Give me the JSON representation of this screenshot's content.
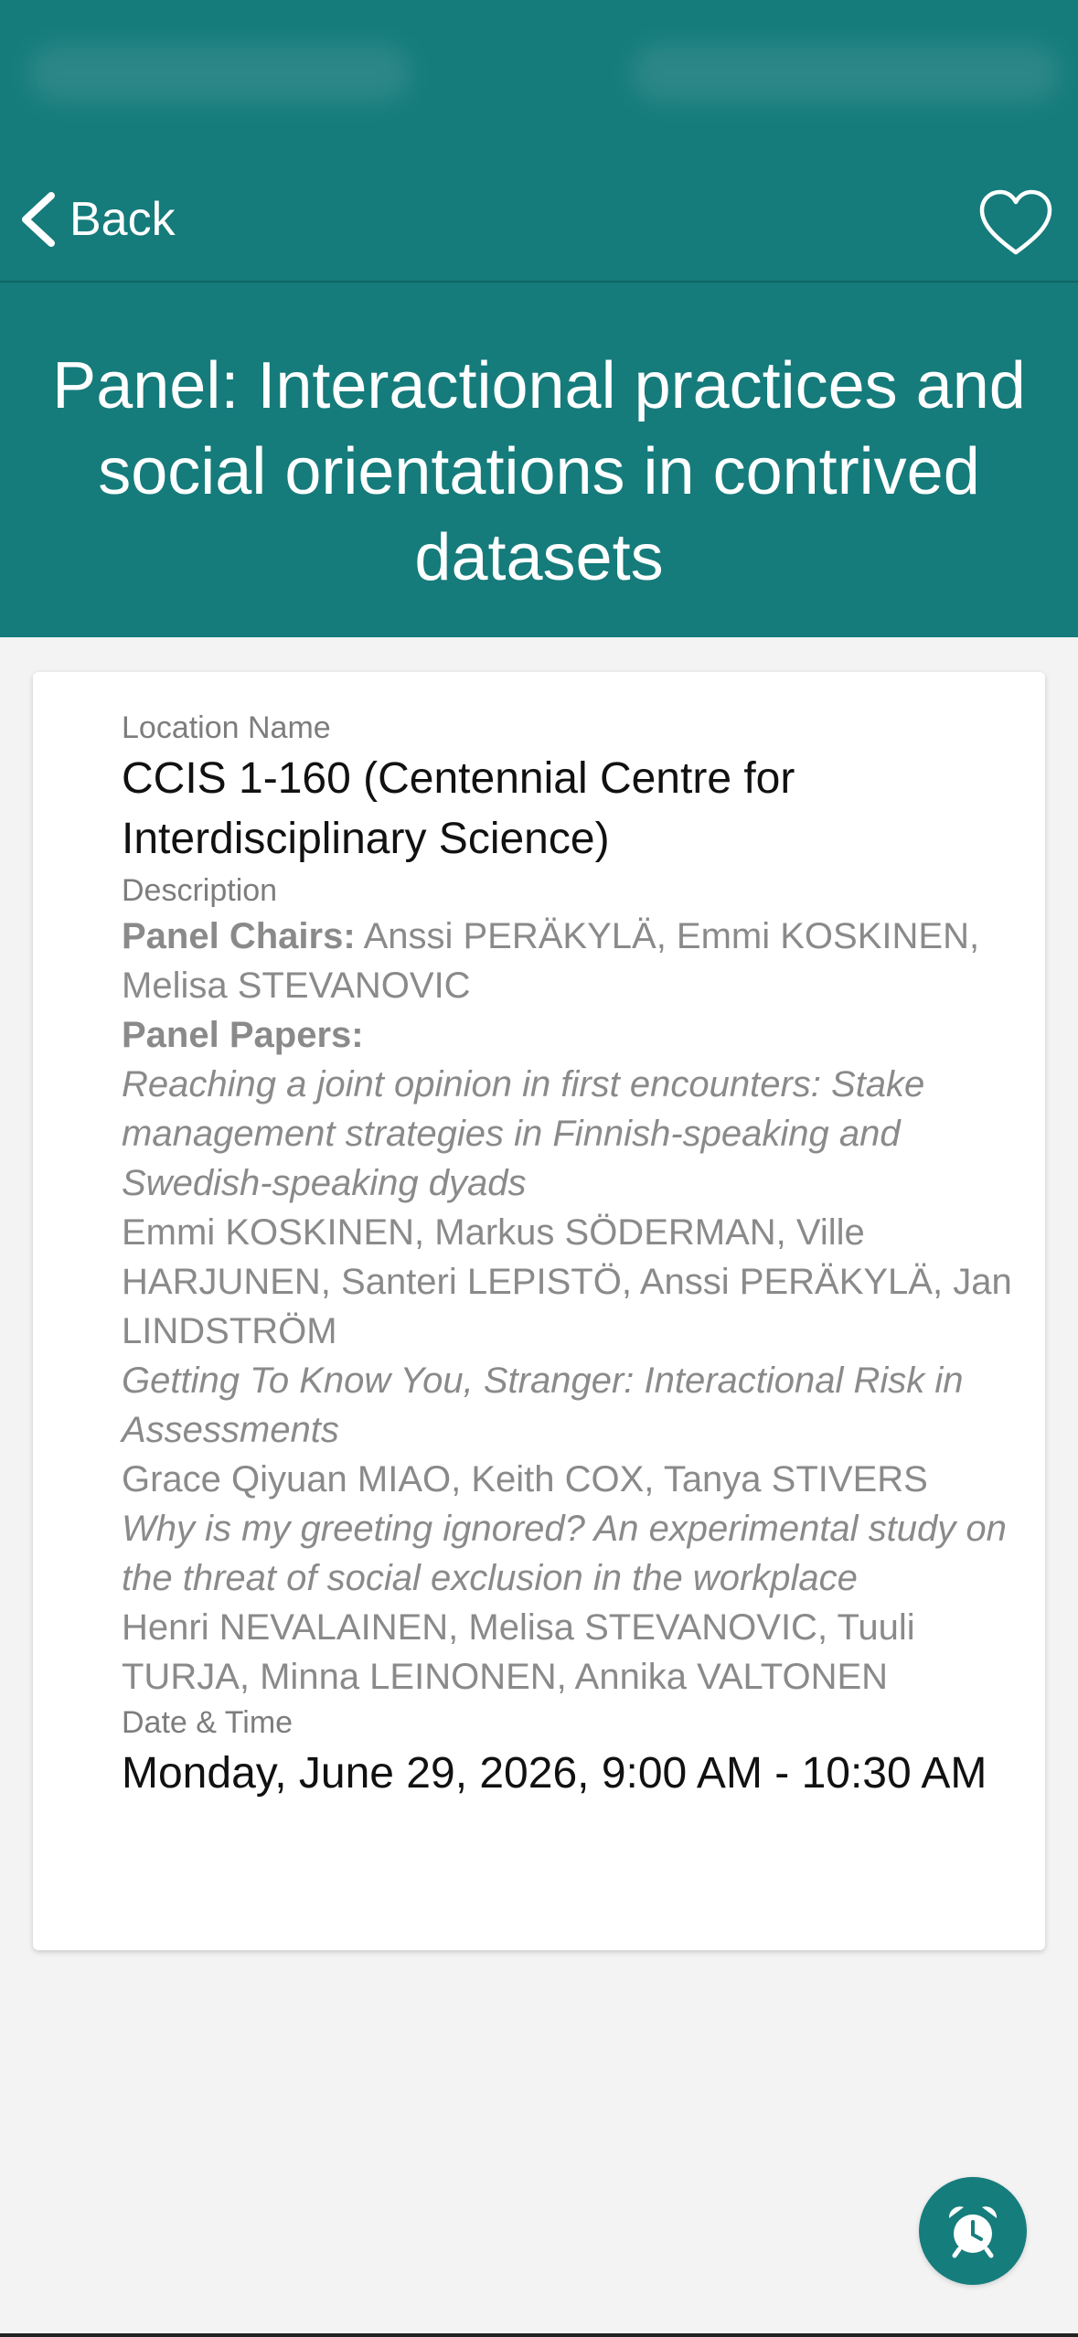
{
  "nav": {
    "back_label": "Back"
  },
  "title": "Panel: Interactional practices and social orientations in contrived datasets",
  "location": {
    "label": "Location Name",
    "value": "CCIS 1-160 (Centennial Centre for Interdisciplinary Science)"
  },
  "description": {
    "label": "Description",
    "chairs_label": "Panel Chairs:",
    "chairs": " Anssi PERÄKYLÄ, Emmi KOSKINEN, Melisa STEVANOVIC",
    "papers_label": "Panel Papers:",
    "papers": [
      {
        "title": "Reaching a joint opinion in first encounters: Stake management strategies in Finnish-speaking and Swedish-speaking dyads",
        "authors": "Emmi KOSKINEN, Markus SÖDERMAN, Ville HARJUNEN, Santeri LEPISTÖ, Anssi PERÄKYLÄ, Jan LINDSTRÖM"
      },
      {
        "title": "Getting To Know You, Stranger: Interactional Risk in Assessments",
        "authors": "Grace Qiyuan MIAO, Keith COX, Tanya STIVERS"
      },
      {
        "title": "Why is my greeting ignored? An experimental study on the threat of social exclusion in the workplace",
        "authors": "Henri NEVALAINEN, Melisa STEVANOVIC, Tuuli TURJA, Minna LEINONEN, Annika VALTONEN"
      }
    ]
  },
  "datetime": {
    "label": "Date & Time",
    "value": "Monday, June 29, 2026, 9:00 AM - 10:30 AM"
  },
  "icons": {
    "back": "chevron-left-icon",
    "favorite": "heart-outline-icon",
    "reminder": "alarm-clock-icon"
  },
  "colors": {
    "header": "#157b7b",
    "background": "#f3f3f3",
    "fab": "#167d7d"
  }
}
